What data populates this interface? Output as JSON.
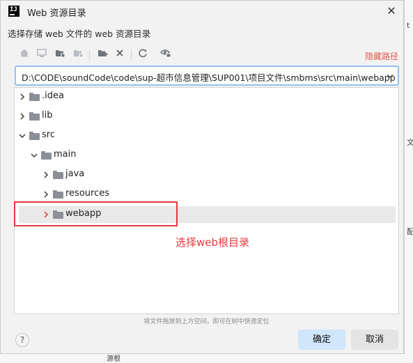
{
  "window": {
    "title": "Web 资源目录",
    "subtitle": "选择存储 web 文件的 web 资源目录",
    "close_glyph": "✕"
  },
  "toolbar": {
    "icons": [
      "home-icon",
      "desktop-icon",
      "folder-project-icon",
      "folder-module-icon",
      "new-folder-icon",
      "delete-icon",
      "refresh-icon",
      "show-hidden-icon"
    ],
    "hide_path_label": "隐藏路径"
  },
  "path": {
    "value": "D:\\CODE\\soundCode\\code\\sup-超市信息管理\\SUP001\\项目文件\\smbms\\src\\main\\webapp",
    "dropdown_glyph": "⌄"
  },
  "tree": {
    "nodes": [
      {
        "label": ".idea",
        "expanded": false
      },
      {
        "label": "lib",
        "expanded": false
      },
      {
        "label": "src",
        "expanded": true
      },
      {
        "label": "main",
        "expanded": true
      },
      {
        "label": "java",
        "expanded": false
      },
      {
        "label": "resources",
        "expanded": false
      },
      {
        "label": "webapp",
        "expanded": false,
        "selected": true
      }
    ]
  },
  "annotation": "选择web根目录",
  "hint": "将文件拖放到上方空间，即可在树中快速定位",
  "buttons": {
    "help": "?",
    "ok": "确定",
    "cancel": "取消"
  },
  "background_fragments": {
    "right_1": "t",
    "right_2": "文件",
    "right_3": "配",
    "bottom": "源根"
  },
  "colors": {
    "accent_blue": "#94c1f0",
    "annotation_red": "#e4393c",
    "hide_path_red": "#e8584f",
    "ok_button": "#cfe6fb"
  }
}
